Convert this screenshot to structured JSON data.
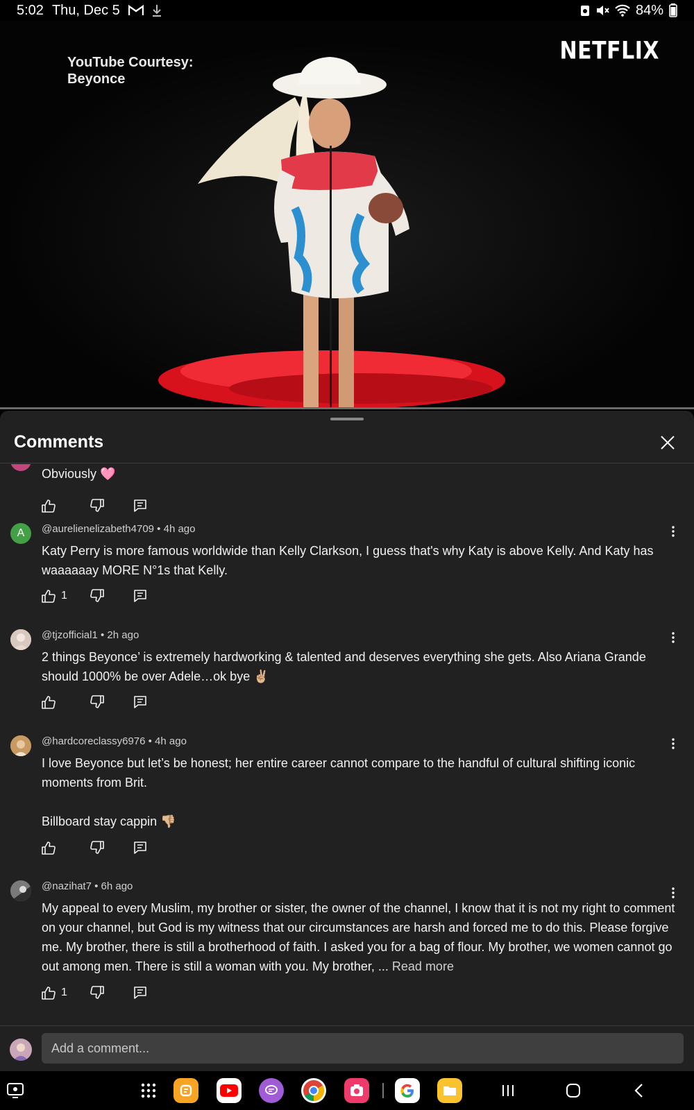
{
  "status_bar": {
    "time": "5:02",
    "date": "Thu, Dec 5",
    "battery": "84%",
    "icons": [
      "gmail-icon",
      "download-icon",
      "alarm-lock-icon",
      "mute-icon",
      "wifi-icon",
      "battery-icon"
    ]
  },
  "video": {
    "courtesy_line1": "YouTube Courtesy:",
    "courtesy_line2": "Beyonce",
    "brand": "NETFLIX"
  },
  "comments_panel": {
    "title": "Comments",
    "comments": [
      {
        "text": "Obviously 🩷"
      },
      {
        "avatar_letter": "A",
        "avatar_color": "#43a047",
        "author": "@aurelienelizabeth4709",
        "time": "4h ago",
        "meta": "@aurelienelizabeth4709 • 4h ago",
        "text": "Katy Perry is more famous worldwide than Kelly Clarkson, I guess that's why Katy is above Kelly. And Katy has waaaaaay MORE N°1s that Kelly.",
        "likes": "1"
      },
      {
        "author": "@tjzofficial1",
        "time": "2h ago",
        "meta": "@tjzofficial1 • 2h ago",
        "text": "2 things Beyonce’ is extremely hardworking & talented and deserves everything she gets. Also Ariana Grande should 1000% be over Adele…ok bye ✌🏼"
      },
      {
        "author": "@hardcoreclassy6976",
        "time": "4h ago",
        "meta": "@hardcoreclassy6976 • 4h ago",
        "text": "I love Beyonce but let’s be honest; her entire career cannot compare to the  handful of cultural shifting iconic moments from Brit.",
        "text2": "Billboard stay cappin 👎🏼"
      },
      {
        "author": "@nazihat7",
        "time": "6h ago",
        "meta": "@nazihat7 • 6h ago",
        "text": "My appeal to every Muslim, my brother or sister, the owner of the channel, I know that it is not my right to comment on your channel, but God is my witness that our circumstances are harsh and forced me to do this. Please forgive me. My brother, there is still a brotherhood of faith. I asked you for a bag of flour. My brother, we women cannot go out among men. There is still a woman with you. My brother, ...",
        "read_more": "Read more",
        "likes": "1"
      }
    ]
  },
  "add_comment": {
    "placeholder": "Add a comment..."
  },
  "navbar": {
    "apps": [
      "grid-apps-icon",
      "bixby-app-icon",
      "youtube-app-icon",
      "messages-app-icon",
      "chrome-app-icon",
      "camera-app-icon",
      "google-app-icon",
      "files-app-icon"
    ],
    "colors": {
      "youtube": "#ff0000",
      "bixby": "#f7a425",
      "messages": "#a05bd6",
      "camera": "#ef3b6b",
      "files": "#f9c22e"
    }
  }
}
